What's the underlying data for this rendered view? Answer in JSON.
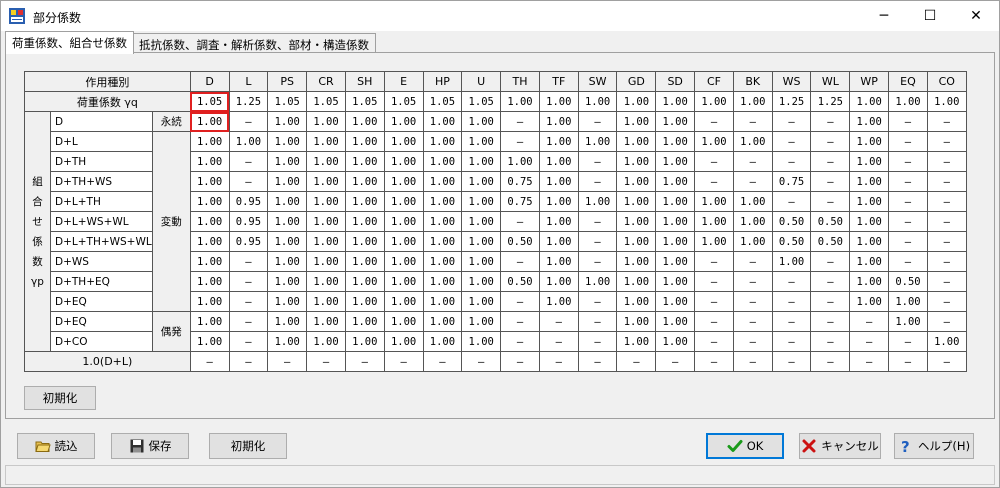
{
  "window": {
    "title": "部分係数",
    "minimize": "─",
    "maximize": "☐",
    "close": "✕"
  },
  "tabs": [
    {
      "label": "荷重係数、組合せ係数",
      "active": true
    },
    {
      "label": "抵抗係数、調査・解析係数、部材・構造係数",
      "active": false
    }
  ],
  "grid": {
    "header_label": "作用種別",
    "columns": [
      "D",
      "L",
      "PS",
      "CR",
      "SH",
      "E",
      "HP",
      "U",
      "TH",
      "TF",
      "SW",
      "GD",
      "SD",
      "CF",
      "BK",
      "WS",
      "WL",
      "WP",
      "EQ",
      "CO"
    ],
    "load_factor_label": "荷重係数 γq",
    "load_factors": [
      "1.05",
      "1.25",
      "1.05",
      "1.05",
      "1.05",
      "1.05",
      "1.05",
      "1.05",
      "1.00",
      "1.00",
      "1.00",
      "1.00",
      "1.00",
      "1.00",
      "1.00",
      "1.25",
      "1.25",
      "1.00",
      "1.00",
      "1.00"
    ],
    "vertical_label": [
      "組",
      "合",
      "せ",
      "係",
      "数",
      "γp"
    ],
    "groups": {
      "permanent": "永続",
      "variable": "変動",
      "accidental": "偶発"
    },
    "combos": [
      {
        "name": "D",
        "values": [
          "1.00",
          "—",
          "1.00",
          "1.00",
          "1.00",
          "1.00",
          "1.00",
          "1.00",
          "—",
          "1.00",
          "—",
          "1.00",
          "1.00",
          "—",
          "—",
          "—",
          "—",
          "1.00",
          "—",
          "—"
        ]
      },
      {
        "name": "D+L",
        "values": [
          "1.00",
          "1.00",
          "1.00",
          "1.00",
          "1.00",
          "1.00",
          "1.00",
          "1.00",
          "—",
          "1.00",
          "1.00",
          "1.00",
          "1.00",
          "1.00",
          "1.00",
          "—",
          "—",
          "1.00",
          "—",
          "—"
        ]
      },
      {
        "name": "D+TH",
        "values": [
          "1.00",
          "—",
          "1.00",
          "1.00",
          "1.00",
          "1.00",
          "1.00",
          "1.00",
          "1.00",
          "1.00",
          "—",
          "1.00",
          "1.00",
          "—",
          "—",
          "—",
          "—",
          "1.00",
          "—",
          "—"
        ]
      },
      {
        "name": "D+TH+WS",
        "values": [
          "1.00",
          "—",
          "1.00",
          "1.00",
          "1.00",
          "1.00",
          "1.00",
          "1.00",
          "0.75",
          "1.00",
          "—",
          "1.00",
          "1.00",
          "—",
          "—",
          "0.75",
          "—",
          "1.00",
          "—",
          "—"
        ]
      },
      {
        "name": "D+L+TH",
        "values": [
          "1.00",
          "0.95",
          "1.00",
          "1.00",
          "1.00",
          "1.00",
          "1.00",
          "1.00",
          "0.75",
          "1.00",
          "1.00",
          "1.00",
          "1.00",
          "1.00",
          "1.00",
          "—",
          "—",
          "1.00",
          "—",
          "—"
        ]
      },
      {
        "name": "D+L+WS+WL",
        "values": [
          "1.00",
          "0.95",
          "1.00",
          "1.00",
          "1.00",
          "1.00",
          "1.00",
          "1.00",
          "—",
          "1.00",
          "—",
          "1.00",
          "1.00",
          "1.00",
          "1.00",
          "0.50",
          "0.50",
          "1.00",
          "—",
          "—"
        ]
      },
      {
        "name": "D+L+TH+WS+WL",
        "values": [
          "1.00",
          "0.95",
          "1.00",
          "1.00",
          "1.00",
          "1.00",
          "1.00",
          "1.00",
          "0.50",
          "1.00",
          "—",
          "1.00",
          "1.00",
          "1.00",
          "1.00",
          "0.50",
          "0.50",
          "1.00",
          "—",
          "—"
        ]
      },
      {
        "name": "D+WS",
        "values": [
          "1.00",
          "—",
          "1.00",
          "1.00",
          "1.00",
          "1.00",
          "1.00",
          "1.00",
          "—",
          "1.00",
          "—",
          "1.00",
          "1.00",
          "—",
          "—",
          "1.00",
          "—",
          "1.00",
          "—",
          "—"
        ]
      },
      {
        "name": "D+TH+EQ",
        "values": [
          "1.00",
          "—",
          "1.00",
          "1.00",
          "1.00",
          "1.00",
          "1.00",
          "1.00",
          "0.50",
          "1.00",
          "1.00",
          "1.00",
          "1.00",
          "—",
          "—",
          "—",
          "—",
          "1.00",
          "0.50",
          "—"
        ]
      },
      {
        "name": "D+EQ",
        "values": [
          "1.00",
          "—",
          "1.00",
          "1.00",
          "1.00",
          "1.00",
          "1.00",
          "1.00",
          "—",
          "1.00",
          "—",
          "1.00",
          "1.00",
          "—",
          "—",
          "—",
          "—",
          "1.00",
          "1.00",
          "—"
        ]
      },
      {
        "name": "D+EQ",
        "values": [
          "1.00",
          "—",
          "1.00",
          "1.00",
          "1.00",
          "1.00",
          "1.00",
          "1.00",
          "—",
          "—",
          "—",
          "1.00",
          "1.00",
          "—",
          "—",
          "—",
          "—",
          "—",
          "1.00",
          "—"
        ]
      },
      {
        "name": "D+CO",
        "values": [
          "1.00",
          "—",
          "1.00",
          "1.00",
          "1.00",
          "1.00",
          "1.00",
          "1.00",
          "—",
          "—",
          "—",
          "1.00",
          "1.00",
          "—",
          "—",
          "—",
          "—",
          "—",
          "—",
          "1.00"
        ]
      }
    ],
    "footer_label": "1.0(D+L)",
    "footer_values": [
      "—",
      "—",
      "—",
      "—",
      "—",
      "—",
      "—",
      "—",
      "—",
      "—",
      "—",
      "—",
      "—",
      "—",
      "—",
      "—",
      "—",
      "—",
      "—",
      "—"
    ]
  },
  "tab_reset_button": "初期化",
  "buttons": {
    "load": "読込",
    "save": "保存",
    "reset": "初期化",
    "ok": "OK",
    "cancel": "キャンセル",
    "help": "ヘルプ(H)"
  },
  "colors": {
    "selection": "#e02020",
    "ok_check": "#1a9a1a",
    "cancel_x": "#cc1111",
    "help_icon": "#1f5fbf"
  }
}
